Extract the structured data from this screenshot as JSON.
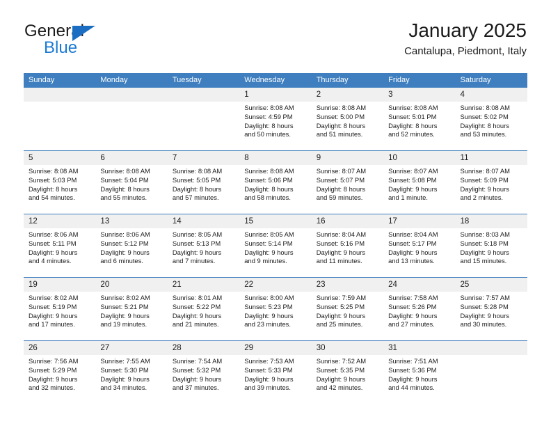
{
  "brand": {
    "word_one": "General",
    "word_two": "Blue",
    "triangle_icon": "blue-triangle-logo-mark",
    "accent_color": "#1b7ad4",
    "header_color": "#3f7fbf"
  },
  "header": {
    "title": "January 2025",
    "location": "Cantalupa, Piedmont, Italy"
  },
  "calendar": {
    "weekday_headers": [
      "Sunday",
      "Monday",
      "Tuesday",
      "Wednesday",
      "Thursday",
      "Friday",
      "Saturday"
    ],
    "labels": {
      "sunrise": "Sunrise:",
      "sunset": "Sunset:",
      "daylight": "Daylight:"
    },
    "weeks": [
      [
        {
          "day": ""
        },
        {
          "day": ""
        },
        {
          "day": ""
        },
        {
          "day": "1",
          "sunrise": "Sunrise: 8:08 AM",
          "sunset": "Sunset: 4:59 PM",
          "daylight_line1": "Daylight: 8 hours",
          "daylight_line2": "and 50 minutes."
        },
        {
          "day": "2",
          "sunrise": "Sunrise: 8:08 AM",
          "sunset": "Sunset: 5:00 PM",
          "daylight_line1": "Daylight: 8 hours",
          "daylight_line2": "and 51 minutes."
        },
        {
          "day": "3",
          "sunrise": "Sunrise: 8:08 AM",
          "sunset": "Sunset: 5:01 PM",
          "daylight_line1": "Daylight: 8 hours",
          "daylight_line2": "and 52 minutes."
        },
        {
          "day": "4",
          "sunrise": "Sunrise: 8:08 AM",
          "sunset": "Sunset: 5:02 PM",
          "daylight_line1": "Daylight: 8 hours",
          "daylight_line2": "and 53 minutes."
        }
      ],
      [
        {
          "day": "5",
          "sunrise": "Sunrise: 8:08 AM",
          "sunset": "Sunset: 5:03 PM",
          "daylight_line1": "Daylight: 8 hours",
          "daylight_line2": "and 54 minutes."
        },
        {
          "day": "6",
          "sunrise": "Sunrise: 8:08 AM",
          "sunset": "Sunset: 5:04 PM",
          "daylight_line1": "Daylight: 8 hours",
          "daylight_line2": "and 55 minutes."
        },
        {
          "day": "7",
          "sunrise": "Sunrise: 8:08 AM",
          "sunset": "Sunset: 5:05 PM",
          "daylight_line1": "Daylight: 8 hours",
          "daylight_line2": "and 57 minutes."
        },
        {
          "day": "8",
          "sunrise": "Sunrise: 8:08 AM",
          "sunset": "Sunset: 5:06 PM",
          "daylight_line1": "Daylight: 8 hours",
          "daylight_line2": "and 58 minutes."
        },
        {
          "day": "9",
          "sunrise": "Sunrise: 8:07 AM",
          "sunset": "Sunset: 5:07 PM",
          "daylight_line1": "Daylight: 8 hours",
          "daylight_line2": "and 59 minutes."
        },
        {
          "day": "10",
          "sunrise": "Sunrise: 8:07 AM",
          "sunset": "Sunset: 5:08 PM",
          "daylight_line1": "Daylight: 9 hours",
          "daylight_line2": "and 1 minute."
        },
        {
          "day": "11",
          "sunrise": "Sunrise: 8:07 AM",
          "sunset": "Sunset: 5:09 PM",
          "daylight_line1": "Daylight: 9 hours",
          "daylight_line2": "and 2 minutes."
        }
      ],
      [
        {
          "day": "12",
          "sunrise": "Sunrise: 8:06 AM",
          "sunset": "Sunset: 5:11 PM",
          "daylight_line1": "Daylight: 9 hours",
          "daylight_line2": "and 4 minutes."
        },
        {
          "day": "13",
          "sunrise": "Sunrise: 8:06 AM",
          "sunset": "Sunset: 5:12 PM",
          "daylight_line1": "Daylight: 9 hours",
          "daylight_line2": "and 6 minutes."
        },
        {
          "day": "14",
          "sunrise": "Sunrise: 8:05 AM",
          "sunset": "Sunset: 5:13 PM",
          "daylight_line1": "Daylight: 9 hours",
          "daylight_line2": "and 7 minutes."
        },
        {
          "day": "15",
          "sunrise": "Sunrise: 8:05 AM",
          "sunset": "Sunset: 5:14 PM",
          "daylight_line1": "Daylight: 9 hours",
          "daylight_line2": "and 9 minutes."
        },
        {
          "day": "16",
          "sunrise": "Sunrise: 8:04 AM",
          "sunset": "Sunset: 5:16 PM",
          "daylight_line1": "Daylight: 9 hours",
          "daylight_line2": "and 11 minutes."
        },
        {
          "day": "17",
          "sunrise": "Sunrise: 8:04 AM",
          "sunset": "Sunset: 5:17 PM",
          "daylight_line1": "Daylight: 9 hours",
          "daylight_line2": "and 13 minutes."
        },
        {
          "day": "18",
          "sunrise": "Sunrise: 8:03 AM",
          "sunset": "Sunset: 5:18 PM",
          "daylight_line1": "Daylight: 9 hours",
          "daylight_line2": "and 15 minutes."
        }
      ],
      [
        {
          "day": "19",
          "sunrise": "Sunrise: 8:02 AM",
          "sunset": "Sunset: 5:19 PM",
          "daylight_line1": "Daylight: 9 hours",
          "daylight_line2": "and 17 minutes."
        },
        {
          "day": "20",
          "sunrise": "Sunrise: 8:02 AM",
          "sunset": "Sunset: 5:21 PM",
          "daylight_line1": "Daylight: 9 hours",
          "daylight_line2": "and 19 minutes."
        },
        {
          "day": "21",
          "sunrise": "Sunrise: 8:01 AM",
          "sunset": "Sunset: 5:22 PM",
          "daylight_line1": "Daylight: 9 hours",
          "daylight_line2": "and 21 minutes."
        },
        {
          "day": "22",
          "sunrise": "Sunrise: 8:00 AM",
          "sunset": "Sunset: 5:23 PM",
          "daylight_line1": "Daylight: 9 hours",
          "daylight_line2": "and 23 minutes."
        },
        {
          "day": "23",
          "sunrise": "Sunrise: 7:59 AM",
          "sunset": "Sunset: 5:25 PM",
          "daylight_line1": "Daylight: 9 hours",
          "daylight_line2": "and 25 minutes."
        },
        {
          "day": "24",
          "sunrise": "Sunrise: 7:58 AM",
          "sunset": "Sunset: 5:26 PM",
          "daylight_line1": "Daylight: 9 hours",
          "daylight_line2": "and 27 minutes."
        },
        {
          "day": "25",
          "sunrise": "Sunrise: 7:57 AM",
          "sunset": "Sunset: 5:28 PM",
          "daylight_line1": "Daylight: 9 hours",
          "daylight_line2": "and 30 minutes."
        }
      ],
      [
        {
          "day": "26",
          "sunrise": "Sunrise: 7:56 AM",
          "sunset": "Sunset: 5:29 PM",
          "daylight_line1": "Daylight: 9 hours",
          "daylight_line2": "and 32 minutes."
        },
        {
          "day": "27",
          "sunrise": "Sunrise: 7:55 AM",
          "sunset": "Sunset: 5:30 PM",
          "daylight_line1": "Daylight: 9 hours",
          "daylight_line2": "and 34 minutes."
        },
        {
          "day": "28",
          "sunrise": "Sunrise: 7:54 AM",
          "sunset": "Sunset: 5:32 PM",
          "daylight_line1": "Daylight: 9 hours",
          "daylight_line2": "and 37 minutes."
        },
        {
          "day": "29",
          "sunrise": "Sunrise: 7:53 AM",
          "sunset": "Sunset: 5:33 PM",
          "daylight_line1": "Daylight: 9 hours",
          "daylight_line2": "and 39 minutes."
        },
        {
          "day": "30",
          "sunrise": "Sunrise: 7:52 AM",
          "sunset": "Sunset: 5:35 PM",
          "daylight_line1": "Daylight: 9 hours",
          "daylight_line2": "and 42 minutes."
        },
        {
          "day": "31",
          "sunrise": "Sunrise: 7:51 AM",
          "sunset": "Sunset: 5:36 PM",
          "daylight_line1": "Daylight: 9 hours",
          "daylight_line2": "and 44 minutes."
        },
        {
          "day": ""
        }
      ]
    ]
  }
}
